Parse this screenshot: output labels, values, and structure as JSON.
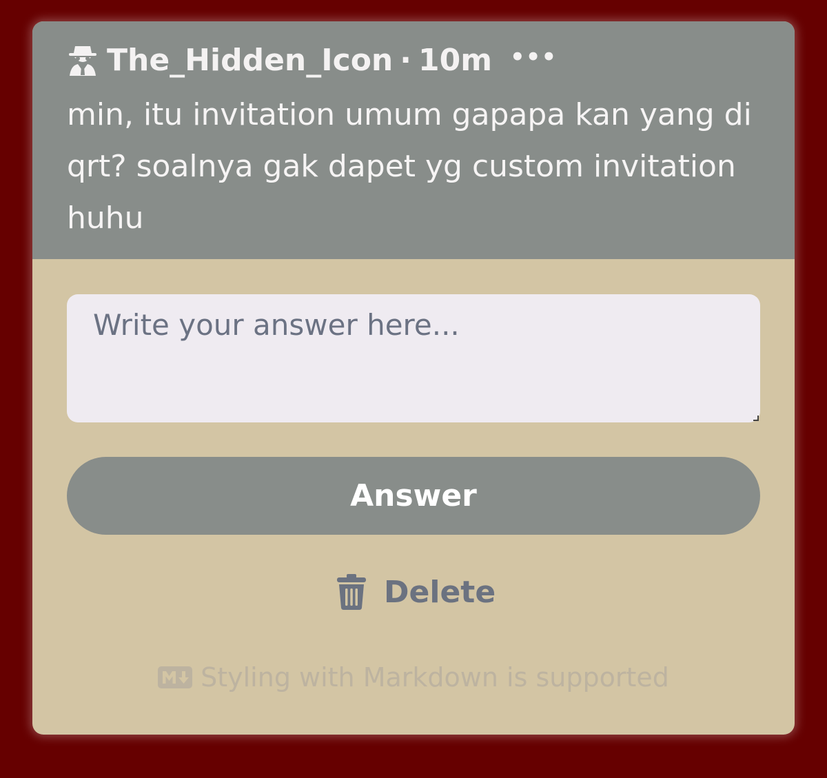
{
  "post": {
    "username": "The_Hidden_Icon",
    "separator": "·",
    "time_ago": "10m",
    "more_label": "•••",
    "question": "min, itu invitation umum gapapa kan yang di qrt? soalnya gak dapet yg custom invitation huhu"
  },
  "form": {
    "answer_placeholder": "Write your answer here...",
    "answer_value": "",
    "answer_button_label": "Answer",
    "delete_label": "Delete",
    "markdown_note": "Styling with Markdown is supported"
  },
  "icons": {
    "user": "spy-icon",
    "more": "more-icon",
    "delete": "trash-icon",
    "markdown": "markdown-icon"
  },
  "colors": {
    "page_background": "#660000",
    "card_header": "#888d8a",
    "card_body": "#d3c5a4",
    "input_background": "#efebf1",
    "button": "#888d8a",
    "delete_text": "#6b7280",
    "note_text": "#bdb3a0"
  }
}
